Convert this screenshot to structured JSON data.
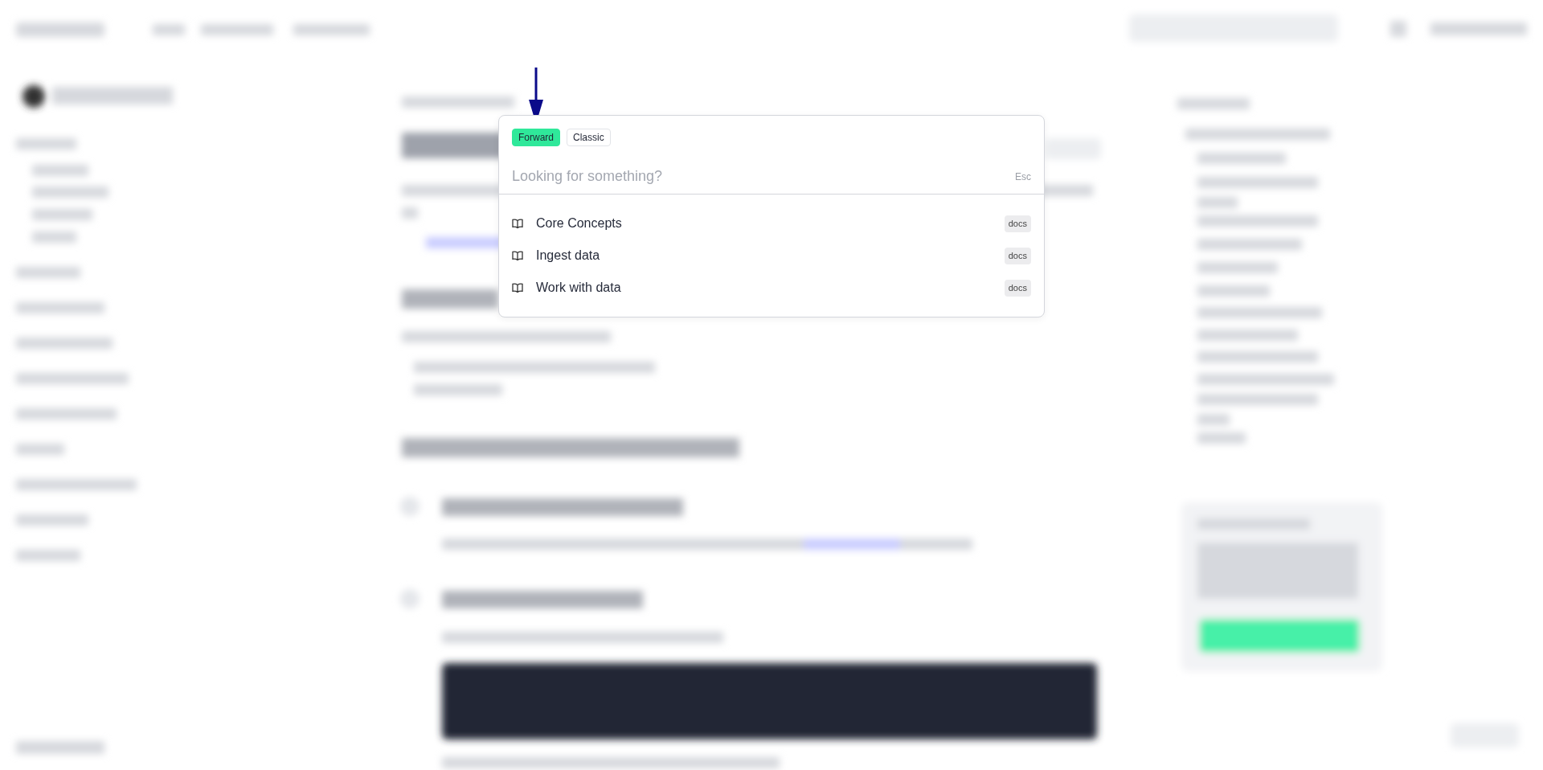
{
  "search_modal": {
    "modes": [
      {
        "label": "Forward",
        "selected": true
      },
      {
        "label": "Classic",
        "selected": false
      }
    ],
    "search": {
      "placeholder": "Looking for something?",
      "shortcut": "Esc"
    },
    "results": [
      {
        "label": "Core Concepts",
        "tag": "docs"
      },
      {
        "label": "Ingest data",
        "tag": "docs"
      },
      {
        "label": "Work with data",
        "tag": "docs"
      }
    ]
  }
}
